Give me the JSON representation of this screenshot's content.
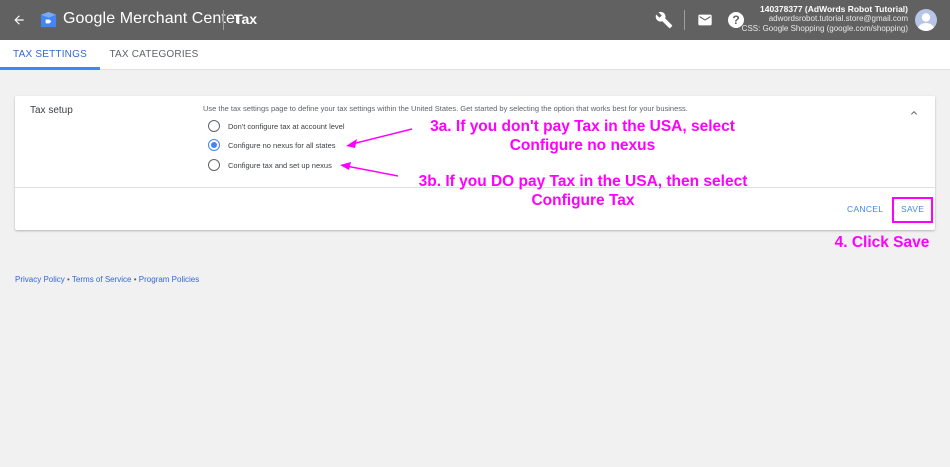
{
  "header": {
    "brand": "Google Merchant Center",
    "page_title": "Tax",
    "account": {
      "name": "140378377 (AdWords Robot Tutorial)",
      "email": "adwordsrobot.tutorial.store@gmail.com",
      "css": "CSS: Google Shopping (google.com/shopping)"
    }
  },
  "tabs": [
    {
      "label": "TAX SETTINGS",
      "active": true
    },
    {
      "label": "TAX CATEGORIES",
      "active": false
    }
  ],
  "tax_setup": {
    "label": "Tax setup",
    "description": "Use the tax settings page to define your tax settings within the United States. Get started by selecting the option that works best for your business.",
    "options": [
      {
        "label": "Don't configure tax at account level",
        "selected": false
      },
      {
        "label": "Configure no nexus for all states",
        "selected": true
      },
      {
        "label": "Configure tax and set up nexus",
        "selected": false
      }
    ],
    "cancel_label": "CANCEL",
    "save_label": "SAVE"
  },
  "annotations": {
    "a3_line1": "3a. If you don't pay Tax in the USA, select",
    "a3_line2": "Configure no nexus",
    "b3_line1": "3b. If you DO pay Tax in the USA, then select",
    "b3_line2": "Configure Tax",
    "save_note": "4. Click Save",
    "color": "#ff00ff"
  },
  "footer": {
    "privacy": "Privacy Policy",
    "terms": "Terms of Service",
    "programs": "Program Policies",
    "separator": "•"
  },
  "colors": {
    "topbar": "#616161",
    "accent": "#4285f4",
    "link": "#3367d6"
  },
  "icons": {
    "back": "arrow-left-icon",
    "logo": "merchant-center-logo-icon",
    "wrench": "wrench-icon",
    "mail": "mail-icon",
    "help": "help-icon",
    "collapse": "chevron-up-icon",
    "avatar": "avatar"
  }
}
